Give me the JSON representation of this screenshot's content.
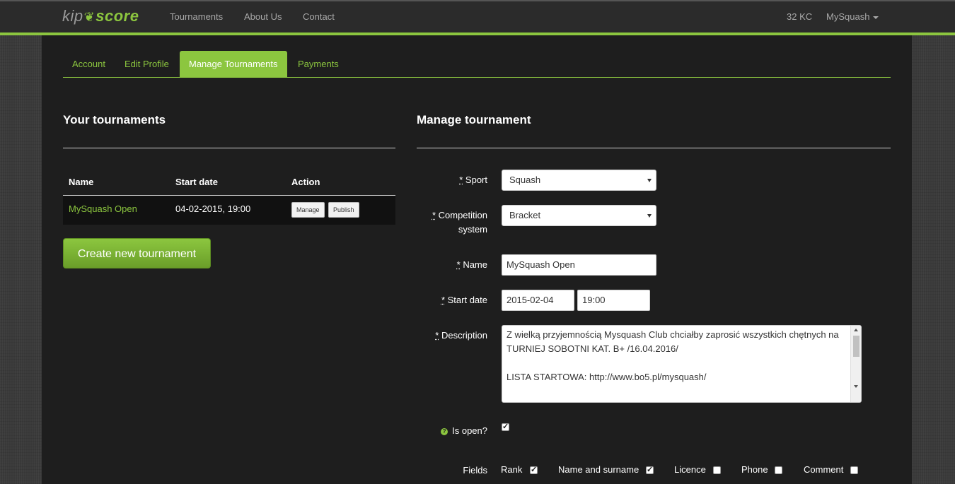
{
  "brand": {
    "kip": "kip",
    "score": "score"
  },
  "nav": {
    "tournaments": "Tournaments",
    "about": "About Us",
    "contact": "Contact"
  },
  "header_right": {
    "credits": "32 KC",
    "user": "MySquash"
  },
  "tabs": [
    {
      "label": "Account",
      "active": false
    },
    {
      "label": "Edit Profile",
      "active": false
    },
    {
      "label": "Manage Tournaments",
      "active": true
    },
    {
      "label": "Payments",
      "active": false
    }
  ],
  "left": {
    "title": "Your tournaments",
    "columns": [
      "Name",
      "Start date",
      "Action"
    ],
    "rows": [
      {
        "name": "MySquash Open",
        "start_date": "04-02-2015, 19:00",
        "manage": "Manage",
        "publish": "Publish"
      }
    ],
    "create_button": "Create new tournament"
  },
  "right": {
    "title": "Manage tournament",
    "sport": {
      "label": "Sport",
      "value": "Squash"
    },
    "competition": {
      "label_1": "Competition",
      "label_2": "system",
      "value": "Bracket"
    },
    "name": {
      "label": "Name",
      "value": "MySquash Open"
    },
    "start_date": {
      "label": "Start date",
      "date": "2015-02-04",
      "time": "19:00"
    },
    "description": {
      "label": "Description",
      "lines": [
        "Z wielką przyjemnością Mysquash Club chciałby zaprosić wszystkich chętnych na TURNIEJ SOBOTNI KAT. B+ /16.04.2016/",
        "",
        "LISTA STARTOWA: http://www.bo5.pl/mysquash/"
      ]
    },
    "is_open": {
      "label": "Is open?",
      "checked": true
    },
    "fields": {
      "label": "Fields",
      "options": [
        {
          "label": "Rank",
          "checked": true
        },
        {
          "label": "Name and surname",
          "checked": true
        },
        {
          "label": "Licence",
          "checked": false
        },
        {
          "label": "Phone",
          "checked": false
        },
        {
          "label": "Comment",
          "checked": false
        }
      ]
    },
    "required_marker": "*"
  },
  "colors": {
    "accent": "#8cc63f",
    "panel": "#1e1e1e",
    "topbar": "#2b2b2b"
  }
}
